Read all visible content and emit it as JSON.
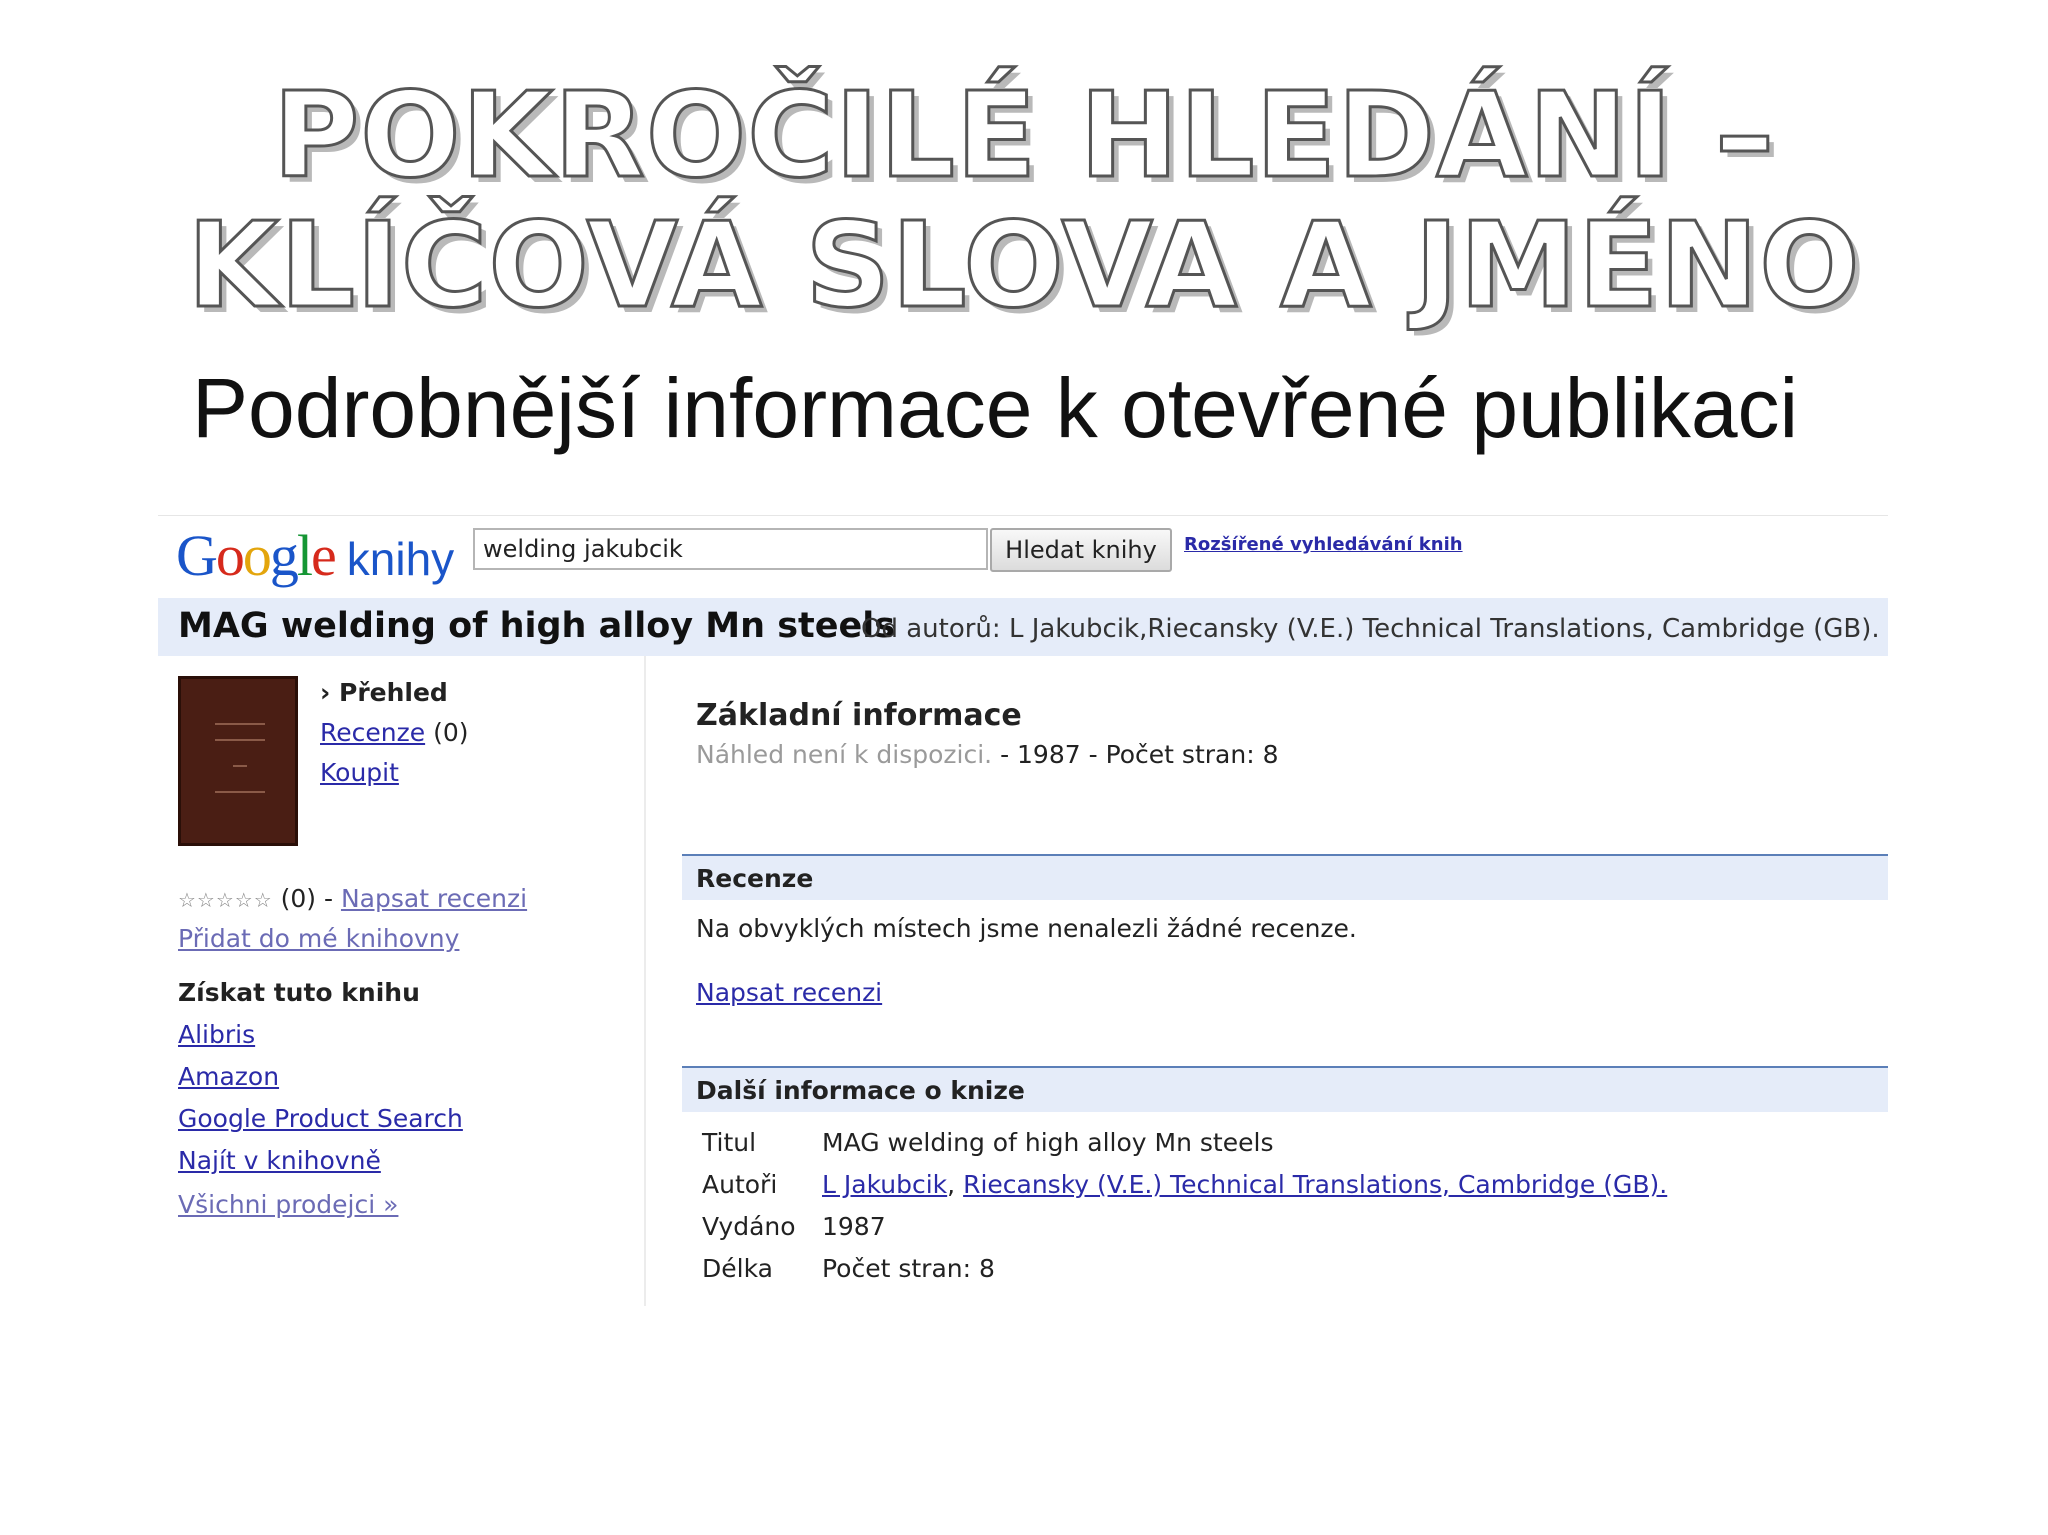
{
  "slide": {
    "title_line1": "POKROČILÉ HLEDÁNÍ –",
    "title_line2": "KLÍČOVÁ SLOVA A JMÉNO",
    "subtitle": "Podrobnější informace k otevřené publikaci"
  },
  "header": {
    "logo_kn": "knihy",
    "search_value": "welding jakubcik",
    "search_button": "Hledat knihy",
    "advanced_link": "Rozšířené vyhledávání knih"
  },
  "book": {
    "title": "MAG welding of high alloy Mn steels",
    "byline": "Od autorů: L Jakubcik,Riecansky (V.E.) Technical Translations, Cambridge (GB)."
  },
  "sidebar": {
    "overview": "› Přehled",
    "reviews_link": "Recenze",
    "reviews_count": "(0)",
    "buy_link": "Koupit",
    "stars": "☆☆☆☆☆",
    "rating_count": "(0) -",
    "write_review_link": "Napsat recenzi",
    "add_library_link": "Přidat do mé knihovny",
    "get_book_heading": "Získat tuto knihu",
    "sellers": [
      "Alibris",
      "Amazon",
      "Google Product Search",
      "Najít v knihovně"
    ],
    "all_sellers_link": "Všichni prodejci »"
  },
  "main": {
    "basic_heading": "Základní informace",
    "preview_na": "Náhled není k dispozici.",
    "basic_meta": "- 1987 - Počet stran: 8",
    "reviews_heading": "Recenze",
    "no_reviews": "Na obvyklých místech jsme nenalezli žádné recenze.",
    "write_review_link": "Napsat recenzi",
    "more_info_heading": "Další informace o knize",
    "info_rows": [
      {
        "label": "Titul",
        "value": "MAG welding of high alloy Mn steels"
      },
      {
        "label": "Autoři",
        "author1": "L Jakubcik",
        "sep": ",",
        "author2": "Riecansky (V.E.) Technical Translations, Cambridge (GB)."
      },
      {
        "label": "Vydáno",
        "value": "1987"
      },
      {
        "label": "Délka",
        "value": "Počet stran: 8"
      }
    ]
  }
}
